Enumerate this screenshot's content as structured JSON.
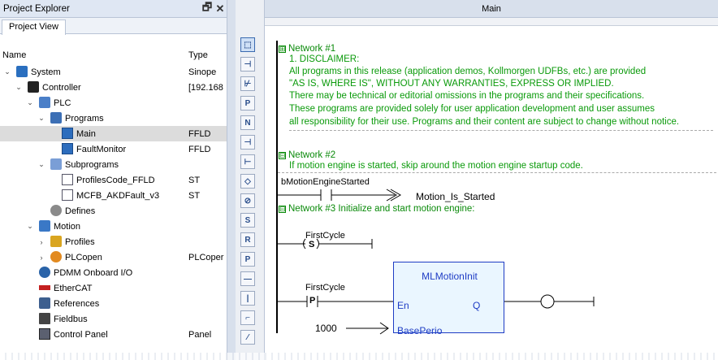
{
  "explorer": {
    "title": "Project Explorer",
    "pin_glyph": "🗗",
    "close_glyph": "✕",
    "tab": "Project View",
    "col_name": "Name",
    "col_type": "Type",
    "rows": [
      {
        "label": "System",
        "type": "Sinope",
        "icon": "system-icon",
        "chev": "⌄"
      },
      {
        "label": "Controller",
        "type": "[192.168",
        "icon": "controller-icon",
        "chev": "⌄"
      },
      {
        "label": "PLC",
        "type": "",
        "icon": "plc-icon",
        "chev": "⌄"
      },
      {
        "label": "Programs",
        "type": "",
        "icon": "programs-folder-icon",
        "chev": "⌄"
      },
      {
        "label": "Main",
        "type": "FFLD",
        "icon": "program-file-icon",
        "chev": ""
      },
      {
        "label": "FaultMonitor",
        "type": "FFLD",
        "icon": "program-file-icon",
        "chev": ""
      },
      {
        "label": "Subprograms",
        "type": "",
        "icon": "subprograms-folder-icon",
        "chev": "⌄"
      },
      {
        "label": "ProfilesCode_FFLD",
        "type": "ST",
        "icon": "st-file-icon",
        "chev": ""
      },
      {
        "label": "MCFB_AKDFault_v3",
        "type": "ST",
        "icon": "st-file-icon",
        "chev": ""
      },
      {
        "label": "Defines",
        "type": "",
        "icon": "defines-icon",
        "chev": ""
      },
      {
        "label": "Motion",
        "type": "",
        "icon": "motion-icon",
        "chev": "⌄"
      },
      {
        "label": "Profiles",
        "type": "",
        "icon": "profiles-icon",
        "chev": "›"
      },
      {
        "label": "PLCopen",
        "type": "PLCoper",
        "icon": "plcopen-icon",
        "chev": "›"
      },
      {
        "label": "PDMM Onboard I/O",
        "type": "",
        "icon": "io-icon",
        "chev": ""
      },
      {
        "label": "EtherCAT",
        "type": "",
        "icon": "ethercat-icon",
        "chev": ""
      },
      {
        "label": "References",
        "type": "",
        "icon": "references-icon",
        "chev": ""
      },
      {
        "label": "Fieldbus",
        "type": "",
        "icon": "fieldbus-icon",
        "chev": ""
      },
      {
        "label": "Control Panel",
        "type": "Panel",
        "icon": "control-panel-icon",
        "chev": ""
      }
    ]
  },
  "editor": {
    "tab_title": "Main",
    "network1": {
      "toggle": "⊞",
      "header": "Network #1",
      "lines": [
        "1. DISCLAIMER:",
        "All programs in this release (application demos, Kollmorgen UDFBs, etc.) are provided",
        "\"AS IS, WHERE IS\", WITHOUT ANY WARRANTIES, EXPRESS OR IMPLIED.",
        "There may be technical or editorial omissions in the programs and their specifications.",
        "These programs are provided solely for user application development and user assumes",
        "all responsibility for their use. Programs and their content are subject to change without notice."
      ]
    },
    "network2": {
      "toggle": "⊟",
      "header": "Network #2",
      "comment": "If motion engine is started, skip around the motion engine startup code.",
      "contact_var": "bMotionEngineStarted",
      "jump_label": "Motion_Is_Started"
    },
    "network3": {
      "toggle": "⊟",
      "header": "Network #3 Initialize and start motion engine:",
      "set_coil_var": "FirstCycle",
      "set_coil_letter": "S",
      "pulse_contact_var": "FirstCycle",
      "pulse_letter": "P",
      "fb_name": "MLMotionInit",
      "fb_en": "En",
      "fb_q": "Q",
      "fb_baseperiod": "BasePerio",
      "const_input": "1000"
    }
  },
  "toolbar": [
    "select-tool-icon",
    "contact-tool-icon",
    "neg-contact-tool-icon",
    "pos-contact-tool-icon",
    "pulse-contact-tool-icon",
    "contact-or-tool-icon",
    "contact-and-tool-icon",
    "coil-tool-icon",
    "neg-coil-tool-icon",
    "set-coil-tool-icon",
    "reset-coil-tool-icon",
    "pulse-coil-tool-icon",
    "horizontal-line-tool-icon",
    "vertical-line-tool-icon",
    "corner-line-tool-icon",
    "diagonal-line-tool-icon"
  ],
  "colors": {
    "comment_green": "#0a9a0a",
    "fb_blue": "#1e3cc4",
    "selected_row": "#dcdcdc",
    "panel_header": "#dfe7f3"
  }
}
